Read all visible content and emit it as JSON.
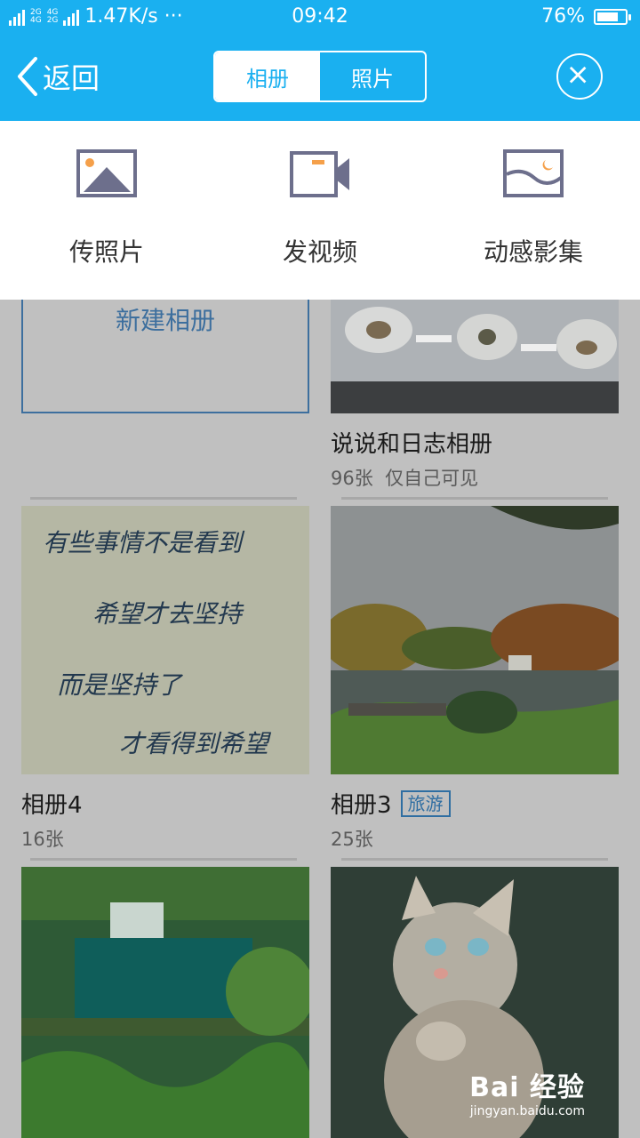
{
  "status": {
    "speed": "1.47K/s ···",
    "time": "09:42",
    "battery": "76%",
    "battery_level": 0.76,
    "net1": "2G",
    "net2": "4G",
    "net3": "4G",
    "net3b": "2G"
  },
  "header": {
    "back_label": "返回",
    "tabs": [
      {
        "label": "相册",
        "active": true
      },
      {
        "label": "照片",
        "active": false
      }
    ]
  },
  "actions": [
    {
      "label": "传照片",
      "icon": "photo-icon"
    },
    {
      "label": "发视频",
      "icon": "video-icon"
    },
    {
      "label": "动感影集",
      "icon": "slideshow-icon"
    }
  ],
  "albums": {
    "new_album_label": "新建相册",
    "items": [
      {
        "title": "说说和日志相册",
        "count": "96张",
        "privacy": "仅自己可见",
        "tag": ""
      },
      {
        "title": "相册4",
        "count": "16张",
        "privacy": "",
        "tag": ""
      },
      {
        "title": "相册3",
        "count": "25张",
        "privacy": "",
        "tag": "旅游"
      }
    ],
    "handwriting": [
      "有些事情不是看到",
      "希望才去坚持",
      "而是坚持了",
      "才看得到希望"
    ]
  },
  "watermark": {
    "brand": "Bai 经验",
    "url": "jingyan.baidu.com"
  },
  "colors": {
    "accent": "#1ab0f0",
    "icon": "#6d6f8c",
    "icon_orange": "#f5a04a"
  }
}
